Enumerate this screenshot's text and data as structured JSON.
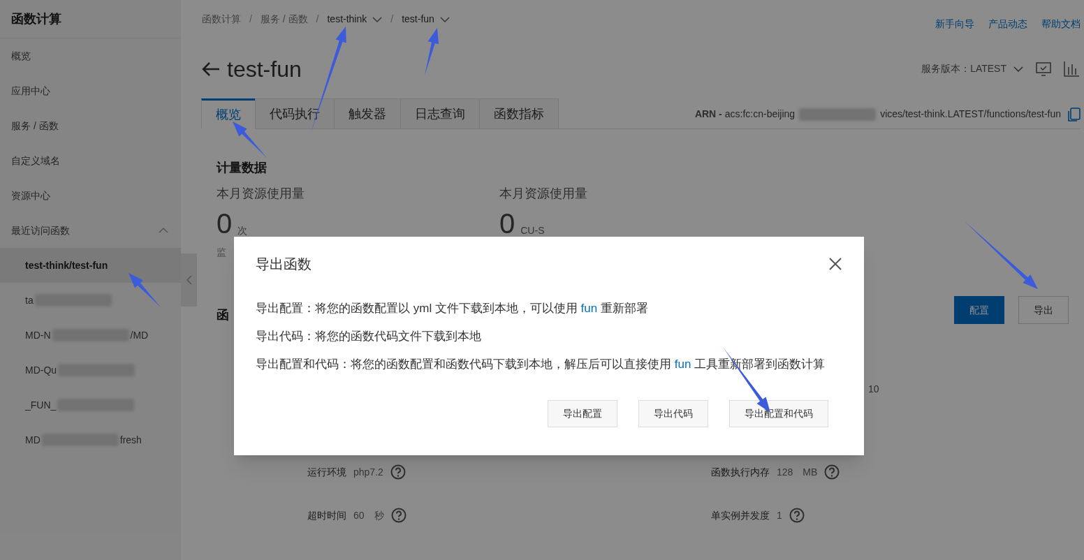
{
  "sidebar": {
    "title": "函数计算",
    "items": [
      {
        "label": "概览",
        "selected": false
      },
      {
        "label": "应用中心",
        "selected": false
      },
      {
        "label": "服务 / 函数",
        "selected": false
      },
      {
        "label": "自定义域名",
        "selected": false
      },
      {
        "label": "资源中心",
        "selected": false
      }
    ],
    "recent": {
      "label": "最近访问函数",
      "expanded": true,
      "items": [
        {
          "selected": true,
          "segments": [
            {
              "kind": "text",
              "text": "test-think/test-fun"
            }
          ]
        },
        {
          "selected": false,
          "segments": [
            {
              "kind": "text",
              "text": "ta"
            },
            {
              "kind": "redacted"
            }
          ]
        },
        {
          "selected": false,
          "segments": [
            {
              "kind": "text",
              "text": "MD-N"
            },
            {
              "kind": "redacted"
            },
            {
              "kind": "text",
              "text": "/MD"
            }
          ]
        },
        {
          "selected": false,
          "segments": [
            {
              "kind": "text",
              "text": "MD-Qu"
            },
            {
              "kind": "redacted"
            }
          ]
        },
        {
          "selected": false,
          "segments": [
            {
              "kind": "text",
              "text": "_FUN_"
            },
            {
              "kind": "redacted"
            }
          ]
        },
        {
          "selected": false,
          "segments": [
            {
              "kind": "text",
              "text": "MD"
            },
            {
              "kind": "redacted"
            },
            {
              "kind": "text",
              "text": "fresh"
            }
          ]
        }
      ]
    }
  },
  "breadcrumb_separator": "/",
  "breadcrumb": [
    {
      "label": "函数计算",
      "dropdown": false
    },
    {
      "label": "服务 / 函数",
      "dropdown": false
    },
    {
      "label": "test-think",
      "dropdown": true
    },
    {
      "label": "test-fun",
      "dropdown": true
    }
  ],
  "top_links": [
    "新手向导",
    "产品动态",
    "帮助文档"
  ],
  "page": {
    "title": "test-fun",
    "version": {
      "label": "服务版本：",
      "value": "LATEST"
    },
    "tabs": [
      {
        "label": "概览",
        "selected": true
      },
      {
        "label": "代码执行",
        "selected": false
      },
      {
        "label": "触发器",
        "selected": false
      },
      {
        "label": "日志查询",
        "selected": false
      },
      {
        "label": "函数指标",
        "selected": false
      }
    ],
    "arn": {
      "label": "ARN -",
      "segments": [
        {
          "kind": "text",
          "text": "acs:fc:cn-beijing"
        },
        {
          "kind": "redacted"
        },
        {
          "kind": "text",
          "text": "vices/test-think.LATEST/functions/test-fun"
        }
      ]
    }
  },
  "metrics": {
    "title": "计量数据",
    "cards": [
      {
        "label": "本月资源使用量",
        "value": "0",
        "unit": "次"
      },
      {
        "label": "本月资源使用量",
        "value": "0",
        "unit": "CU-S"
      }
    ],
    "note": "监"
  },
  "section_title": "函",
  "actions": [
    {
      "label": "配置",
      "kind": "primary"
    },
    {
      "label": "导出",
      "kind": "default"
    }
  ],
  "partial_value": "10",
  "fields": [
    {
      "label": "运行环境",
      "value": "php7.2"
    },
    {
      "label": "函数执行内存",
      "value": "128",
      "unit": "MB"
    },
    {
      "label": "超时时间",
      "value": "60",
      "unit": "秒"
    },
    {
      "label": "单实例并发度",
      "value": "1"
    }
  ],
  "dialog": {
    "title": "导出函数",
    "lines": [
      {
        "before": "导出配置：将您的函数配置以 yml 文件下载到本地，可以使用 ",
        "link": "fun",
        "after": " 重新部署"
      },
      {
        "before": "导出代码：将您的函数代码文件下载到本地"
      },
      {
        "before": "导出配置和代码：将您的函数配置和函数代码下载到本地，解压后可以直接使用 ",
        "link": "fun",
        "after": " 工具重新部署到函数计算"
      }
    ],
    "buttons": [
      "导出配置",
      "导出代码",
      "导出配置和代码"
    ]
  }
}
